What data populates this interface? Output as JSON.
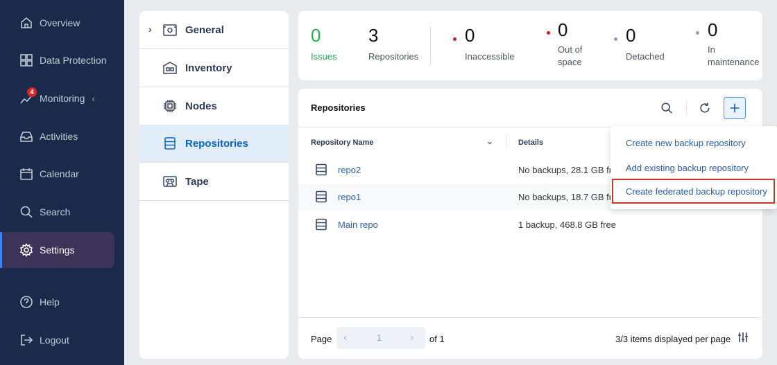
{
  "sidebar": {
    "items": [
      {
        "label": "Overview",
        "icon": "home-icon"
      },
      {
        "label": "Data Protection",
        "icon": "grid-icon"
      },
      {
        "label": "Monitoring",
        "icon": "chart-line-icon",
        "badge": "4"
      },
      {
        "label": "Activities",
        "icon": "inbox-icon"
      },
      {
        "label": "Calendar",
        "icon": "calendar-icon"
      },
      {
        "label": "Search",
        "icon": "search-icon"
      },
      {
        "label": "Settings",
        "icon": "gear-icon",
        "active": true
      },
      {
        "label": "Help",
        "icon": "help-icon"
      },
      {
        "label": "Logout",
        "icon": "logout-icon"
      }
    ]
  },
  "settings_menu": {
    "items": [
      {
        "label": "General",
        "icon": "gear-box-icon"
      },
      {
        "label": "Inventory",
        "icon": "building-icon"
      },
      {
        "label": "Nodes",
        "icon": "chip-icon"
      },
      {
        "label": "Repositories",
        "icon": "storage-icon",
        "active": true
      },
      {
        "label": "Tape",
        "icon": "tape-icon"
      }
    ]
  },
  "stats": {
    "issues": {
      "value": "0",
      "label": "Issues"
    },
    "repositories": {
      "value": "3",
      "label": "Repositories"
    },
    "inaccessible": {
      "value": "0",
      "label": "Inaccessible"
    },
    "out_of_space": {
      "value": "0",
      "label_line1": "Out of",
      "label_line2": "space"
    },
    "detached": {
      "value": "0",
      "label": "Detached"
    },
    "in_maintenance": {
      "value": "0",
      "label_line1": "In",
      "label_line2": "maintenance"
    }
  },
  "repositories_panel": {
    "title": "Repositories",
    "columns": {
      "name": "Repository Name",
      "details": "Details"
    },
    "rows": [
      {
        "name": "repo2",
        "details": "No backups, 28.1 GB free"
      },
      {
        "name": "repo1",
        "details": "No backups, 18.7 GB free"
      },
      {
        "name": "Main repo",
        "details": "1 backup, 468.8 GB free"
      }
    ],
    "pager": {
      "label": "Page",
      "current": "1",
      "of": "of 1"
    },
    "per_page_text": "3/3 items displayed per page"
  },
  "add_menu": {
    "items": [
      "Create new backup repository",
      "Add existing backup repository",
      "Create federated backup repository"
    ]
  },
  "colors": {
    "sidebar_bg": "#1b2a4a",
    "active_accent": "#3b82f6",
    "issues_green": "#22b14c",
    "dot_red": "#d11a1a",
    "dot_grey": "#8aa0bb",
    "highlight_border": "#c0392b"
  }
}
